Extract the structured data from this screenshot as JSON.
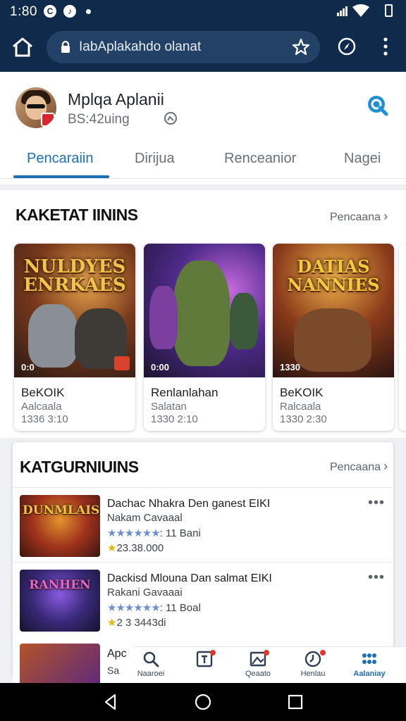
{
  "status_bar": {
    "time": "1:80"
  },
  "browser": {
    "url": "IabAplakahdo olanat"
  },
  "profile": {
    "name": "Mplqa Aplanii",
    "subtitle": "BS:42uing"
  },
  "tabs": [
    {
      "label": "Pencaraiin",
      "active": true
    },
    {
      "label": "Dirijua",
      "active": false
    },
    {
      "label": "Renceanior",
      "active": false
    },
    {
      "label": "Nagei",
      "active": false
    }
  ],
  "featured": {
    "title": "KAKETAT IININS",
    "more_label": "Pencaana",
    "cards": [
      {
        "art_logo": "NULDYES ENRKAES",
        "duration": "0:0",
        "title": "BeKOIK",
        "subtitle": "Aalcaala",
        "meta": "1336 3:10"
      },
      {
        "art_logo": "",
        "duration": "0:00",
        "title": "Renlanlahan",
        "subtitle": "Salatan",
        "meta": "1330 2:10"
      },
      {
        "art_logo": "DATIAS NANNIES",
        "duration": "1330",
        "title": "BeKOIK",
        "subtitle": "Ralcaala",
        "meta": "1330 2:30"
      }
    ]
  },
  "categories": {
    "title": "KATGURNIUINS",
    "more_label": "Pencaana",
    "items": [
      {
        "thumb_logo": "DUNMLAIS",
        "title": "Dachac Nhakra Den ganest EIKI",
        "subtitle": "Nakam Cavaaal",
        "stars": "★★★★★★",
        "rating_text": ": 11 Bani",
        "count": "23.38.000"
      },
      {
        "thumb_logo": "RANHEN",
        "title": "Dackisd Mlouna Dan salmat EIKI",
        "subtitle": "Rakani Gavaaai",
        "stars": "★★★★★★",
        "rating_text": ": 11 Boal",
        "count": "2 3 3443di"
      }
    ],
    "partial_item": {
      "title": "Apc",
      "subtitle": "Sa"
    }
  },
  "bottom_nav": [
    {
      "label": "Naaroei",
      "icon": "search-icon",
      "active": false
    },
    {
      "label": "",
      "icon": "tablet-icon",
      "active": false
    },
    {
      "label": "Qeaato",
      "icon": "photo-icon",
      "active": false
    },
    {
      "label": "Henlau",
      "icon": "history-icon",
      "active": false
    },
    {
      "label": "Aalaniay",
      "icon": "grid-icon",
      "active": true
    }
  ],
  "colors": {
    "topbar": "#0f2a4a",
    "accent": "#1f6fb5",
    "notification": "#e0362d"
  }
}
